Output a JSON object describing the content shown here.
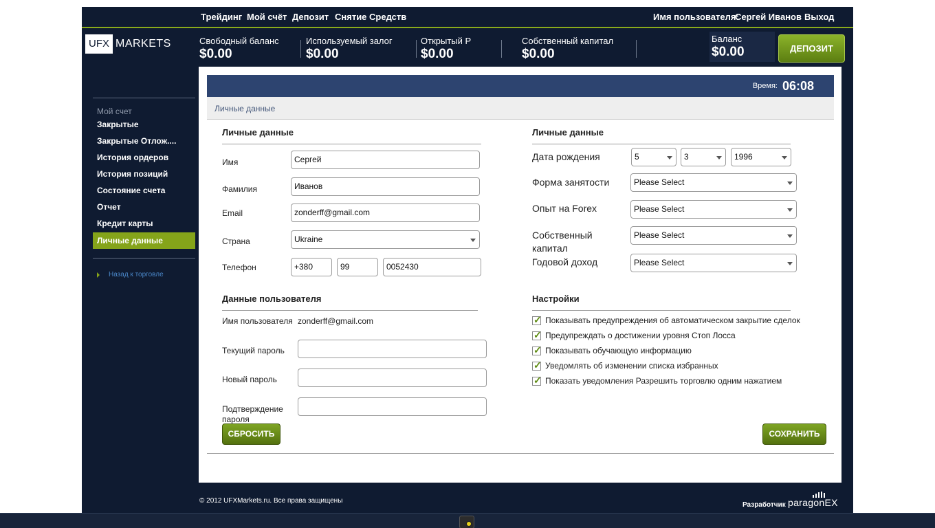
{
  "nav": {
    "trading": "Трейдинг",
    "my_account": "Мой счёт",
    "deposit": "Депозит",
    "withdraw": "Снятие Средств",
    "username_label": "Имя пользователя:",
    "username": "Сергей Иванов",
    "logout": "Выход"
  },
  "logo": {
    "box": "UFX",
    "text": "MARKETS"
  },
  "stats": {
    "free_balance_label": "Свободный баланс",
    "free_balance": "$0.00",
    "used_margin_label": "Используемый залог",
    "used_margin": "$0.00",
    "open_pl_label": "Открытый Р",
    "open_pl": "$0.00",
    "equity_label": "Собственный капитал",
    "equity": "$0.00",
    "balance_label": "Баланс",
    "balance": "$0.00",
    "deposit_button": "ДЕПОЗИТ"
  },
  "sidebar": {
    "title": "Мой счет",
    "items": [
      {
        "label": "Закрытые"
      },
      {
        "label": "Закрытые Отлож...."
      },
      {
        "label": "История ордеров"
      },
      {
        "label": "История позиций"
      },
      {
        "label": "Состояние счета"
      },
      {
        "label": "Отчет"
      },
      {
        "label": "Кредит карты"
      },
      {
        "label": "Личные данные",
        "active": true
      }
    ],
    "back_link": "Назад к торговле"
  },
  "header": {
    "time_label": "Время:",
    "time": "06:08",
    "breadcrumb": "Личные данные"
  },
  "personal": {
    "title": "Личные данные",
    "first_name_label": "Имя",
    "first_name": "Сергей",
    "last_name_label": "Фамилия",
    "last_name": "Иванов",
    "email_label": "Email",
    "email": "zonderff@gmail.com",
    "country_label": "Страна",
    "country": "Ukraine",
    "phone_label": "Телефон",
    "phone_code": "+380",
    "phone_area": "99",
    "phone_number": "0052430"
  },
  "personal2": {
    "title": "Личные данные",
    "birth_label": "Дата рождения",
    "birth_day": "5",
    "birth_month": "3",
    "birth_year": "1996",
    "employment_label": "Форма занятости",
    "employment": "Please Select",
    "forex_label": "Опыт на Forex",
    "forex": "Please Select",
    "capital_label_1": "Собственный",
    "capital_label_2": "капитал",
    "capital": "Please Select",
    "income_label": "Годовой доход",
    "income": "Please Select"
  },
  "user": {
    "title": "Данные пользователя",
    "username_label": "Имя пользователя",
    "username": "zonderff@gmail.com",
    "current_password_label": "Текущий пароль",
    "new_password_label": "Новый пароль",
    "confirm_label_1": "Подтверждение",
    "confirm_label_2": "пароля"
  },
  "settings": {
    "title": "Настройки",
    "options": [
      {
        "label": "Показывать  предупреждения об автоматическом закрытие сделок",
        "checked": true
      },
      {
        "label": "Предупреждать о достижении уровня Стоп Лосса",
        "checked": true
      },
      {
        "label": "Показывать обучающую информацию",
        "checked": true
      },
      {
        "label": "Уведомлять об изменении списка избранных",
        "checked": true
      },
      {
        "label": "Показать уведомления  Разрешить торговлю одним нажатием",
        "checked": true
      }
    ]
  },
  "buttons": {
    "reset": "СБРОСИТЬ",
    "save": "СОХРАНИТЬ"
  },
  "footer": {
    "copyright": "© 2012 UFXMarkets.ru. Все права защищены",
    "developer_label": "Разработчик",
    "developer_logo": "paragonEX"
  },
  "colors": {
    "navy": "#0f1b31",
    "accent_green": "#85a41a",
    "header_blue": "#2d4470"
  }
}
